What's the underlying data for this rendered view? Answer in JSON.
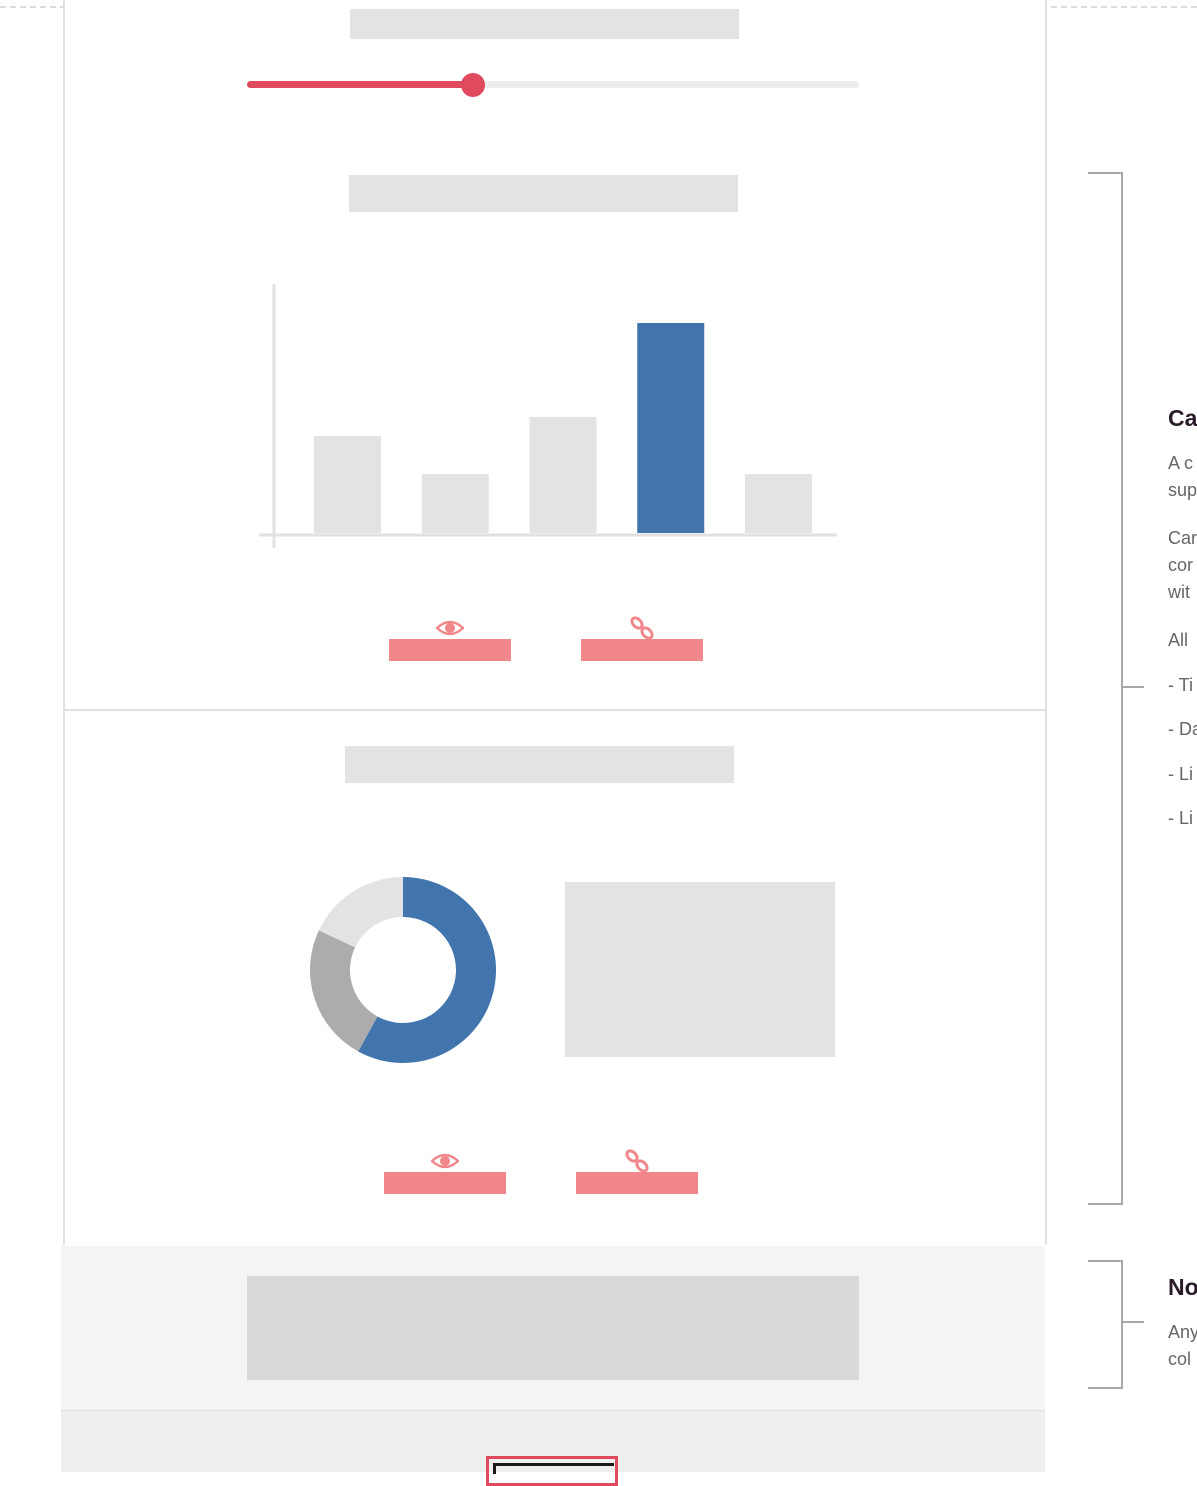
{
  "slider": {
    "value": 0.37
  },
  "bar_panel": {
    "chart_data": {
      "type": "bar",
      "values": [
        97,
        59,
        116,
        210,
        59
      ],
      "highlight_index": 3,
      "colors": {
        "highlight": "#4275ad",
        "default": "#e3e3e3",
        "axis": "#e1e1e1"
      }
    },
    "actions": [
      {
        "icon": "eye-icon"
      },
      {
        "icon": "link-icon"
      }
    ]
  },
  "donut_panel": {
    "chart_data": {
      "type": "pie",
      "values": [
        58,
        24,
        18
      ],
      "colors": [
        "#4275ad",
        "#acacac",
        "#e3e3e3"
      ]
    },
    "actions": [
      {
        "icon": "eye-icon"
      },
      {
        "icon": "link-icon"
      }
    ]
  },
  "annotations": [
    {
      "title": "Ca",
      "lines": [
        "A c",
        "sup",
        "Car",
        "cor",
        "wit",
        "All",
        "- Ti",
        "- Da",
        "- Li",
        "- Li"
      ]
    },
    {
      "title": "No",
      "lines": [
        "Any",
        "col"
      ]
    }
  ],
  "colors": {
    "accent": "#e04a5e",
    "action": "#f2878b",
    "placeholder": "#e3e3e3"
  }
}
